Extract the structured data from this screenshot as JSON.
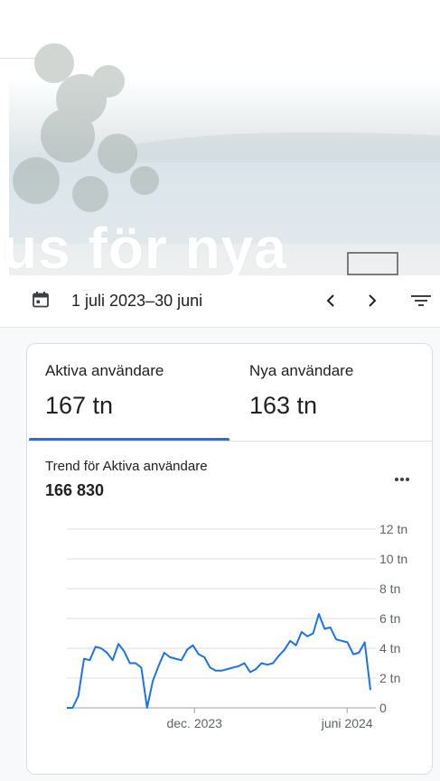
{
  "hero": {
    "text": "us för nya"
  },
  "date_bar": {
    "range": "1 juli 2023–30 juni",
    "icons": [
      "calendar-icon",
      "chevron-left-icon",
      "chevron-right-icon",
      "filter-icon"
    ]
  },
  "tabs": [
    {
      "label": "Aktiva användare",
      "value": "167 tn",
      "selected": true
    },
    {
      "label": "Nya användare",
      "value": "163 tn",
      "selected": false
    }
  ],
  "trend": {
    "title": "Trend för Aktiva användare",
    "value": "166 830"
  },
  "colors": {
    "accent": "#1a73e8",
    "line": "#1a73e8",
    "grid": "#dadce0"
  },
  "chart_data": {
    "type": "line",
    "x": [
      "2023-07-01",
      "2023-07-08",
      "2023-07-15",
      "2023-07-22",
      "2023-07-29",
      "2023-08-05",
      "2023-08-12",
      "2023-08-19",
      "2023-08-26",
      "2023-09-02",
      "2023-09-09",
      "2023-09-16",
      "2023-09-23",
      "2023-09-30",
      "2023-10-07",
      "2023-10-14",
      "2023-10-21",
      "2023-10-28",
      "2023-11-04",
      "2023-11-11",
      "2023-11-18",
      "2023-11-25",
      "2023-12-02",
      "2023-12-09",
      "2023-12-16",
      "2023-12-23",
      "2023-12-30",
      "2024-01-06",
      "2024-01-13",
      "2024-01-20",
      "2024-01-27",
      "2024-02-03",
      "2024-02-10",
      "2024-02-17",
      "2024-02-24",
      "2024-03-02",
      "2024-03-09",
      "2024-03-16",
      "2024-03-23",
      "2024-03-30",
      "2024-04-06",
      "2024-04-13",
      "2024-04-20",
      "2024-04-27",
      "2024-05-04",
      "2024-05-11",
      "2024-05-18",
      "2024-05-25",
      "2024-06-01",
      "2024-06-08",
      "2024-06-15",
      "2024-06-22",
      "2024-06-29"
    ],
    "series": [
      {
        "values": [
          0,
          0,
          0.8,
          3.3,
          3.2,
          4.1,
          4.0,
          3.7,
          3.2,
          4.3,
          3.8,
          3.0,
          3.0,
          2.7,
          0,
          1.8,
          2.8,
          3.7,
          3.4,
          3.3,
          3.2,
          3.9,
          4.2,
          3.6,
          3.4,
          2.7,
          2.5,
          2.5,
          2.6,
          2.7,
          2.8,
          3.0,
          2.4,
          2.6,
          3.0,
          2.9,
          3.0,
          3.5,
          3.9,
          4.5,
          4.2,
          5.1,
          4.8,
          5.0,
          6.3,
          5.3,
          5.4,
          4.6,
          4.5,
          4.4,
          3.6,
          3.7,
          4.4,
          1.2
        ]
      }
    ],
    "y_ticks": [
      "0",
      "2 tn",
      "4 tn",
      "6 tn",
      "8 tn",
      "10 tn",
      "12 tn"
    ],
    "x_ticks": [
      {
        "label": "dec. 2023",
        "x": "2023-12-01"
      },
      {
        "label": "juni 2024",
        "x": "2024-06-01"
      }
    ],
    "ylim": [
      0,
      12
    ],
    "grid": true,
    "y_axis_position": "right"
  }
}
